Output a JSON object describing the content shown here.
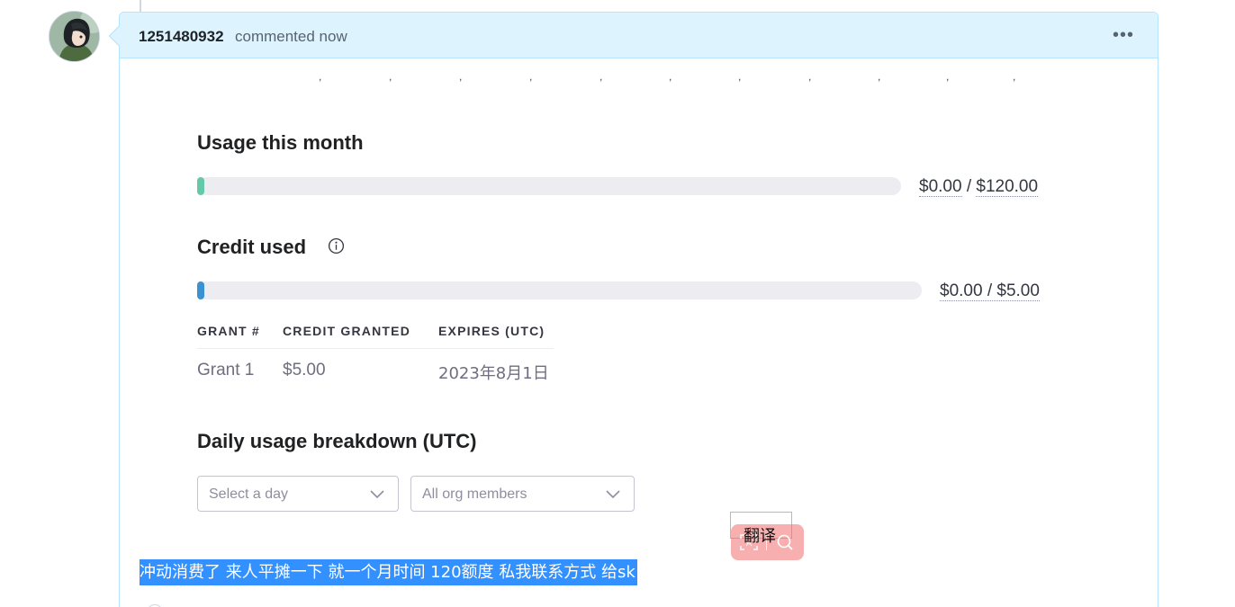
{
  "comment": {
    "author": "1251480932",
    "meta": "commented now",
    "menu_icon": "kebab-horizontal-icon",
    "avatar_icon": "anime-avatar"
  },
  "axis_ticks": [
    ",",
    ",",
    ",",
    ",",
    ",",
    ",",
    ",",
    ",",
    ",",
    ",",
    ","
  ],
  "usage": {
    "title": "Usage this month",
    "used": "$0.00",
    "separator": " / ",
    "limit": "$120.00",
    "fraction": 0.005,
    "color": "#65c8a8"
  },
  "credit": {
    "title": "Credit used",
    "info_icon": "info-icon",
    "amount": "$0.00 / $5.00",
    "fraction": 0.005,
    "color": "#3b91d1"
  },
  "grants": {
    "headers": [
      "GRANT #",
      "CREDIT GRANTED",
      "EXPIRES (UTC)"
    ],
    "rows": [
      [
        "Grant 1",
        "$5.00",
        "2023年8月1日"
      ]
    ]
  },
  "daily": {
    "title": "Daily usage breakdown (UTC)",
    "day_select": "Select a day",
    "member_select": "All org members"
  },
  "translate": {
    "label": "翻译",
    "ocr_icon": "scan-text-icon",
    "search_icon": "search-icon"
  },
  "selected_text": "冲动消费了 来人平摊一下 就一个月时间 120额度 私我联系方式 给sk"
}
